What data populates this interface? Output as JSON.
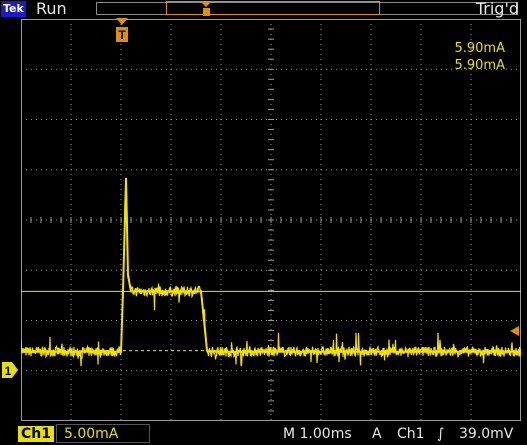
{
  "header": {
    "brand": "Tek",
    "run_state": "Run",
    "trigger_state": "Trig'd"
  },
  "markers": {
    "trigger_position": "T",
    "channel": "1"
  },
  "readouts": {
    "line1": "5.90mA",
    "line2": "5.90mA"
  },
  "footer": {
    "channel": "Ch1",
    "vertical_scale": "5.00mA",
    "timebase": "M 1.00ms",
    "trigger_mode": "A",
    "trigger_source": "Ch1",
    "trigger_slope_symbol": "∫",
    "trigger_level": "39.0mV"
  },
  "colors": {
    "trace": "#f2e200",
    "grid": "#9a9a9a",
    "trigger_marker": "#e09000",
    "brand_bg": "#1b1bc8"
  },
  "chart_data": {
    "type": "line",
    "title": "",
    "xlabel": "",
    "ylabel": "",
    "x_unit": "ms",
    "y_unit": "mA",
    "xlim": [
      -0.1,
      9.9
    ],
    "ylim": [
      -7.0,
      33.0
    ],
    "grid": true,
    "series": [
      {
        "x": [
          -0.1,
          1.9,
          1.94,
          2.0,
          2.04,
          2.1,
          2.3,
          3.5,
          3.54,
          3.62,
          3.7,
          5.0,
          7.0,
          8.0,
          9.9
        ],
        "y": [
          -0.1,
          -0.1,
          5.9,
          17.2,
          7.5,
          5.9,
          5.9,
          5.9,
          4.0,
          0.0,
          -0.1,
          -0.1,
          -0.1,
          -0.1,
          -0.1
        ]
      }
    ],
    "cursor_level": 5.9,
    "ground_level": 0.0
  }
}
